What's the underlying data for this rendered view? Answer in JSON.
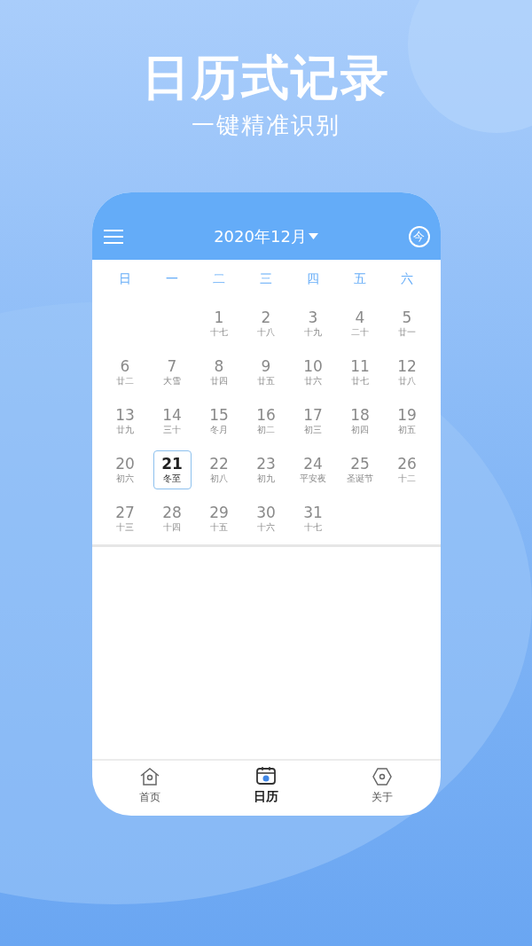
{
  "headline": {
    "title": "日历式记录",
    "subtitle": "一键精准识别"
  },
  "calendar": {
    "month": "2020年12月",
    "today_button": "今",
    "weekdays": [
      "日",
      "一",
      "二",
      "三",
      "四",
      "五",
      "六"
    ],
    "weeks": [
      {
        "days": [
          {
            "day": "1",
            "lunar": "十七",
            "selected": false
          },
          {
            "day": "2",
            "lunar": "十八",
            "selected": false
          },
          {
            "day": "3",
            "lunar": "十九",
            "selected": false
          },
          {
            "day": "4",
            "lunar": "二十",
            "selected": false
          },
          {
            "day": "5",
            "lunar": "廿一",
            "selected": false
          }
        ]
      },
      {
        "days": [
          {
            "day": "6",
            "lunar": "廿二",
            "selected": false
          },
          {
            "day": "7",
            "lunar": "大雪",
            "selected": false
          },
          {
            "day": "8",
            "lunar": "廿四",
            "selected": false
          },
          {
            "day": "9",
            "lunar": "廿五",
            "selected": false
          },
          {
            "day": "10",
            "lunar": "廿六",
            "selected": false
          },
          {
            "day": "11",
            "lunar": "廿七",
            "selected": false
          },
          {
            "day": "12",
            "lunar": "廿八",
            "selected": false
          }
        ]
      },
      {
        "days": [
          {
            "day": "13",
            "lunar": "廿九",
            "selected": false
          },
          {
            "day": "14",
            "lunar": "三十",
            "selected": false
          },
          {
            "day": "15",
            "lunar": "冬月",
            "selected": false
          },
          {
            "day": "16",
            "lunar": "初二",
            "selected": false
          },
          {
            "day": "17",
            "lunar": "初三",
            "selected": false
          },
          {
            "day": "18",
            "lunar": "初四",
            "selected": false
          },
          {
            "day": "19",
            "lunar": "初五",
            "selected": false
          }
        ]
      },
      {
        "days": [
          {
            "day": "20",
            "lunar": "初六",
            "selected": false
          },
          {
            "day": "21",
            "lunar": "冬至",
            "selected": true
          },
          {
            "day": "22",
            "lunar": "初八",
            "selected": false
          },
          {
            "day": "23",
            "lunar": "初九",
            "selected": false
          },
          {
            "day": "24",
            "lunar": "平安夜",
            "selected": false
          },
          {
            "day": "25",
            "lunar": "圣诞节",
            "selected": false
          },
          {
            "day": "26",
            "lunar": "十二",
            "selected": false
          }
        ]
      },
      {
        "days": [
          {
            "day": "27",
            "lunar": "十三",
            "selected": false
          },
          {
            "day": "28",
            "lunar": "十四",
            "selected": false
          },
          {
            "day": "29",
            "lunar": "十五",
            "selected": false
          },
          {
            "day": "30",
            "lunar": "十六",
            "selected": false
          },
          {
            "day": "31",
            "lunar": "十七",
            "selected": false
          }
        ]
      }
    ]
  },
  "nav": [
    {
      "kind": "home",
      "label": "首页",
      "selected": false
    },
    {
      "kind": "calendar",
      "label": "日历",
      "selected": true
    },
    {
      "kind": "about",
      "label": "关于",
      "selected": false
    }
  ]
}
